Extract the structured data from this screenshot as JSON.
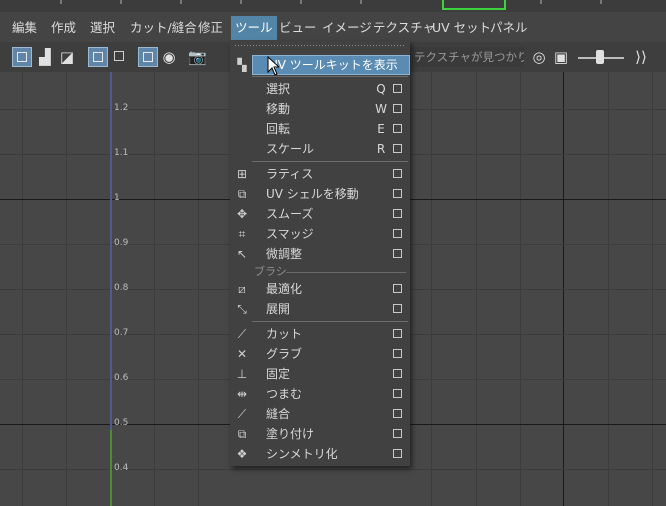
{
  "menubar": {
    "items": [
      "編集",
      "作成",
      "選択",
      "カット/縫合",
      "修正",
      "ツール",
      "ビュー",
      "イメージ",
      "テクスチャ",
      "UV セット",
      "パネル"
    ],
    "active_index": 5
  },
  "toolbar": {
    "texture_label": "テクスチャが見つかり…"
  },
  "viewport": {
    "v_labels": [
      "1.2",
      "1.1",
      "1",
      "0.9",
      "0.8",
      "0.7",
      "0.6",
      "0.5",
      "0.4"
    ]
  },
  "tools_menu": {
    "header_item": "UV ツールキットを表示",
    "items": [
      {
        "label": "選択",
        "key": "Q"
      },
      {
        "label": "移動",
        "key": "W"
      },
      {
        "label": "回転",
        "key": "E"
      },
      {
        "label": "スケール",
        "key": "R"
      },
      {
        "label": "ラティス",
        "key": ""
      },
      {
        "label": "UV シェルを移動",
        "key": ""
      },
      {
        "label": "スムーズ",
        "key": ""
      },
      {
        "label": "スマッジ",
        "key": ""
      },
      {
        "label": "微調整",
        "key": ""
      },
      {
        "label": "最適化",
        "key": ""
      },
      {
        "label": "展開",
        "key": ""
      },
      {
        "label": "カット",
        "key": ""
      },
      {
        "label": "グラブ",
        "key": ""
      },
      {
        "label": "固定",
        "key": ""
      },
      {
        "label": "つまむ",
        "key": ""
      },
      {
        "label": "縫合",
        "key": ""
      },
      {
        "label": "塗り付け",
        "key": ""
      },
      {
        "label": "シンメトリ化",
        "key": ""
      }
    ],
    "section_brush": "ブラシ"
  },
  "colors": {
    "highlight": "#5a8bb3",
    "active_menu": "#5285a6",
    "background": "#444444"
  }
}
